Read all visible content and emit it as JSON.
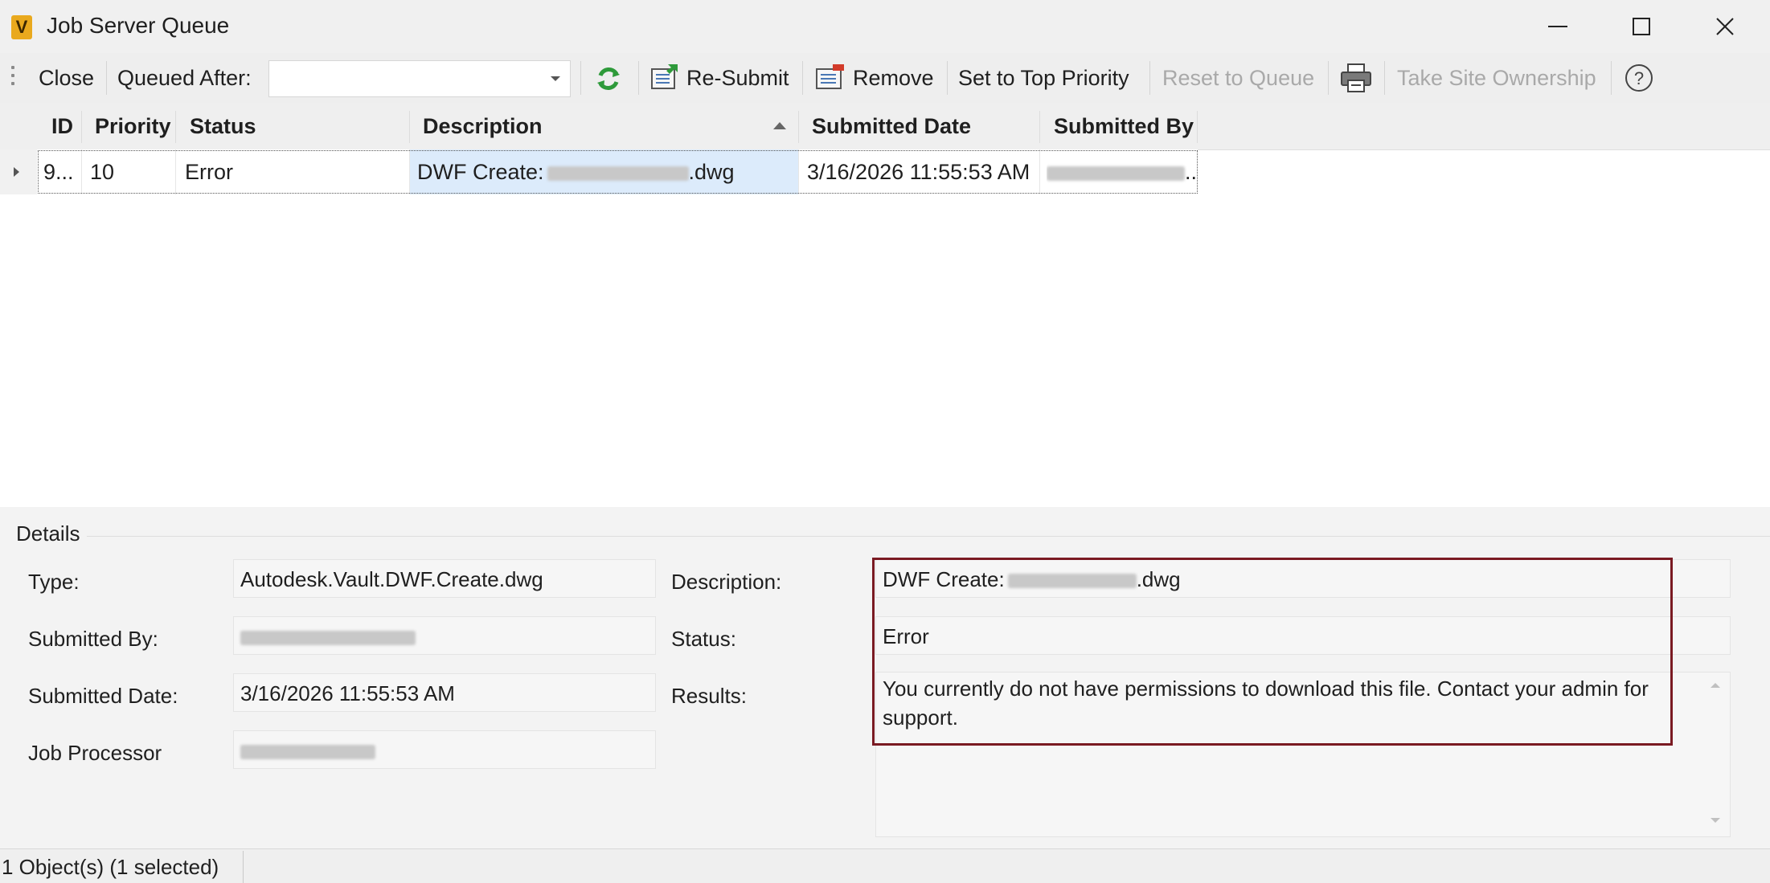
{
  "window": {
    "title": "Job Server Queue",
    "app_icon_letter": "V",
    "app_icon_color": "#e9a91e"
  },
  "toolbar": {
    "close_label": "Close",
    "queued_after_label": "Queued After:",
    "queued_after_value": "",
    "refresh_icon": "refresh-icon",
    "resubmit_label": "Re-Submit",
    "remove_label": "Remove",
    "set_top_priority_label": "Set to Top Priority",
    "reset_to_queue_label": "Reset to Queue",
    "print_icon": "print-icon",
    "take_site_ownership_label": "Take Site Ownership",
    "help_icon": "help-icon"
  },
  "grid": {
    "columns": [
      "ID",
      "Priority",
      "Status",
      "Description",
      "Submitted Date",
      "Submitted By"
    ],
    "sorted_column": "Description",
    "sort_direction": "ascending",
    "rows": [
      {
        "id": "9...",
        "priority": "10",
        "status": "Error",
        "description_prefix": "DWF Create:",
        "description_suffix": ".dwg",
        "submitted_date": "3/16/2026 11:55:53 AM",
        "submitted_by": ".."
      }
    ]
  },
  "details": {
    "section_title": "Details",
    "type_label": "Type:",
    "type_value": "Autodesk.Vault.DWF.Create.dwg",
    "submitted_by_label": "Submitted By:",
    "submitted_date_label": "Submitted Date:",
    "submitted_date_value": "3/16/2026 11:55:53 AM",
    "job_processor_label": "Job Processor",
    "description_label": "Description:",
    "description_prefix": "DWF Create:",
    "description_suffix": ".dwg",
    "status_label": "Status:",
    "status_value": "Error",
    "results_label": "Results:",
    "results_value": "You currently do not have permissions to download this file. Contact your admin for support."
  },
  "statusbar": {
    "text": "1 Object(s) (1 selected)"
  },
  "colors": {
    "highlight_border": "#7a1a22",
    "selected_cell": "#dcebfb",
    "refresh_green": "#2e9a3a"
  }
}
